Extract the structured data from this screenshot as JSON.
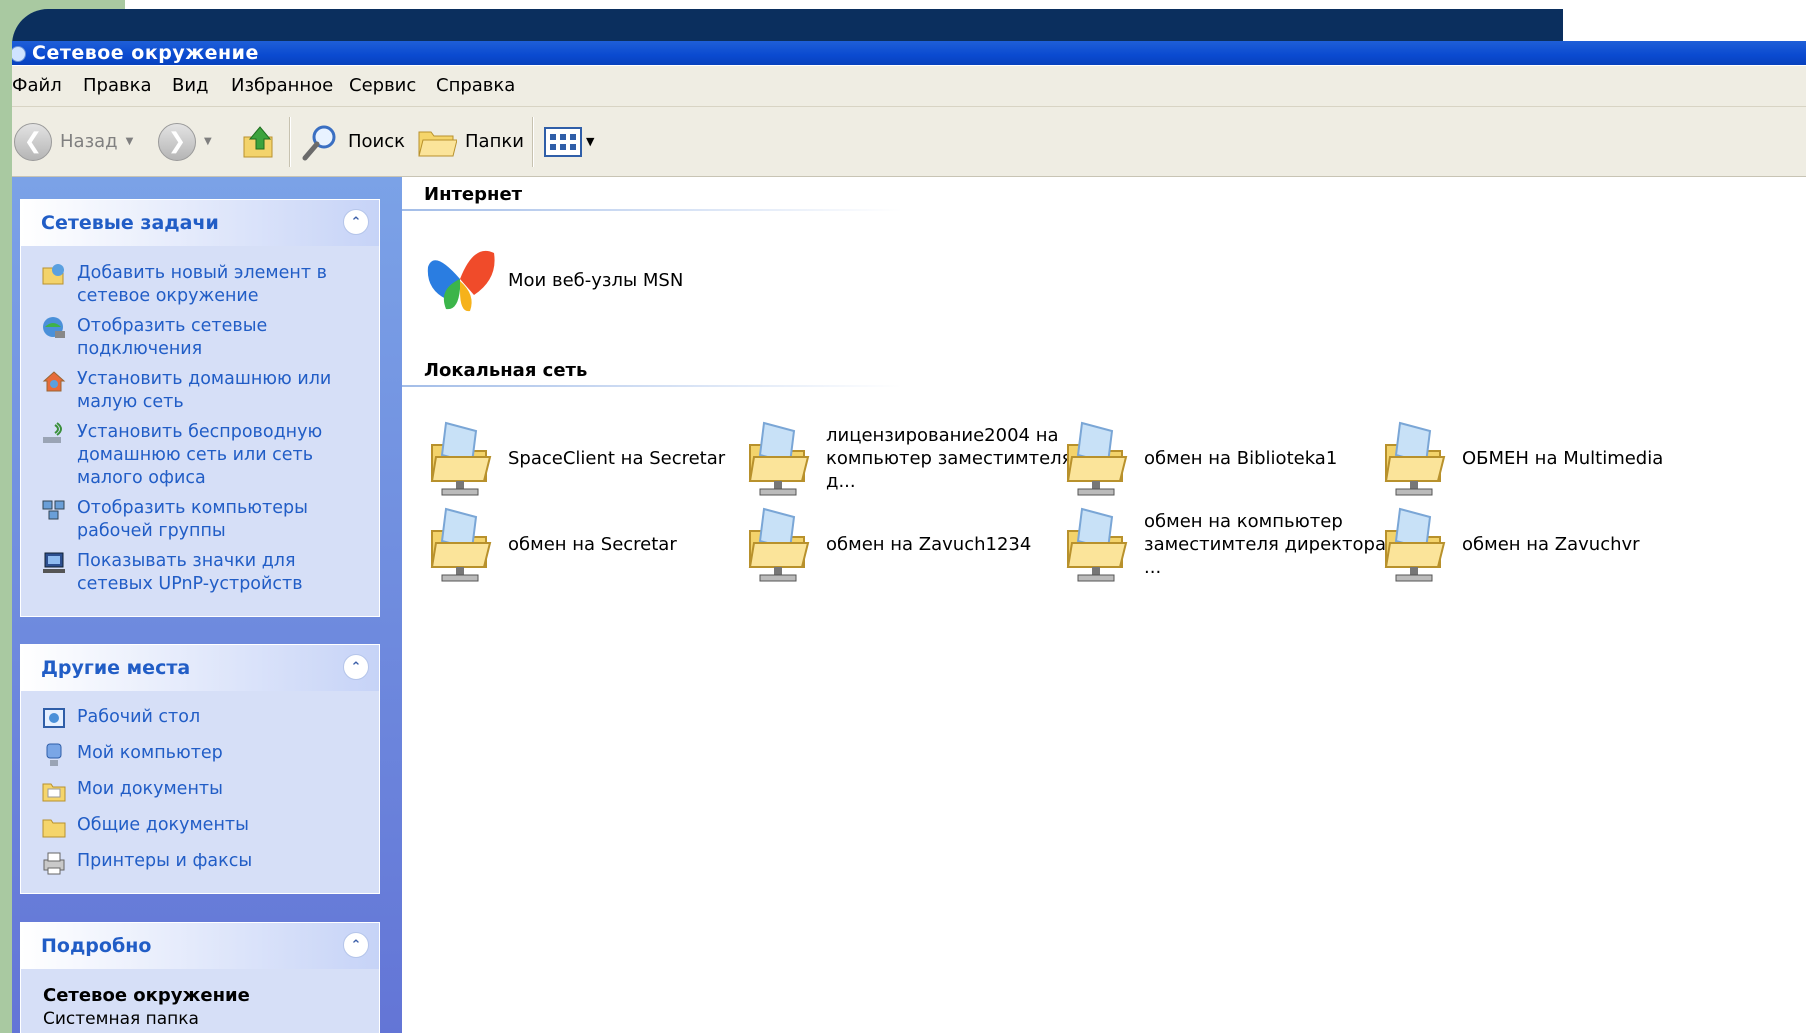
{
  "window": {
    "title": "Сетевое окружение"
  },
  "menu": [
    "Файл",
    "Правка",
    "Вид",
    "Избранное",
    "Сервис",
    "Справка"
  ],
  "toolbar": {
    "back_label": "Назад",
    "search_label": "Поиск",
    "folders_label": "Папки"
  },
  "network_tasks": {
    "title": "Сетевые задачи",
    "items": [
      "Добавить новый элемент в сетевое окружение",
      "Отобразить сетевые подключения",
      "Установить домашнюю или малую сеть",
      "Установить беспроводную домашнюю сеть или сеть малого офиса",
      "Отобразить компьютеры рабочей группы",
      "Показывать значки для сетевых UPnP-устройств"
    ]
  },
  "other_places": {
    "title": "Другие места",
    "items": [
      "Рабочий стол",
      "Мой компьютер",
      "Мои документы",
      "Общие документы",
      "Принтеры и факсы"
    ]
  },
  "details": {
    "title": "Подробно",
    "name": "Сетевое окружение",
    "type": "Системная папка"
  },
  "content": {
    "internet": {
      "title": "Интернет",
      "items": [
        "Мои веб-узлы MSN"
      ]
    },
    "local": {
      "title": "Локальная сеть",
      "items": [
        "SpaceClient на Secretar",
        "лицензирование2004 на компьютер заместимтеля д...",
        "обмен на Biblioteka1",
        "ОБМЕН на Multimedia",
        "обмен на Secretar",
        "обмен на Zavuch1234",
        "обмен на компьютер заместимтеля директора ...",
        "обмен на Zavuchvr"
      ]
    }
  }
}
